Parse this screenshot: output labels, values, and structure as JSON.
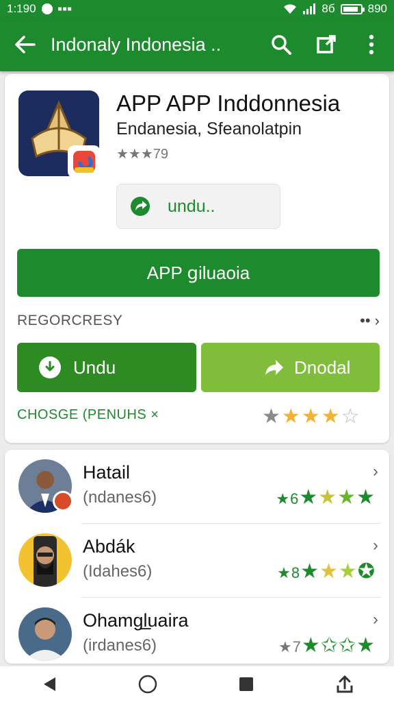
{
  "status_bar": {
    "time": "1:190",
    "signal_text": "8б",
    "battery_text": "890"
  },
  "app_bar": {
    "title": "Indonaly Indonesia .."
  },
  "app": {
    "title": "APP APP Inddonnesia",
    "subtitle": "Endanesia, Sfeanolatpin",
    "rating_text": "★★★79",
    "install_label": "undu..",
    "primary_button": "APP ցiluaoia"
  },
  "section": {
    "label": "REGORCRESY",
    "more": "•• ›"
  },
  "actions": {
    "left_label": "Undu",
    "right_label": "Dnodal"
  },
  "choose": {
    "label": "CHOSGE (PENUHS ×",
    "stars": [
      {
        "glyph": "★",
        "color": "#8a8a8a"
      },
      {
        "glyph": "★",
        "color": "#f2b233"
      },
      {
        "glyph": "★",
        "color": "#f2b233"
      },
      {
        "glyph": "★",
        "color": "#f2b233"
      },
      {
        "glyph": "☆",
        "color": "#bcbcbc"
      }
    ]
  },
  "reviews": [
    {
      "name": "Hatail",
      "sub": "(ndanes6)",
      "num": "★6",
      "stars": [
        {
          "glyph": "★",
          "color": "#1e8a2e"
        },
        {
          "glyph": "★",
          "color": "#c9c23b"
        },
        {
          "glyph": "★",
          "color": "#6ab530"
        },
        {
          "glyph": "★",
          "color": "#1e8a2e"
        }
      ]
    },
    {
      "name": "Abdák",
      "sub": "(Idahes6)",
      "num": "★8",
      "stars": [
        {
          "glyph": "★",
          "color": "#1e8a2e"
        },
        {
          "glyph": "★",
          "color": "#e2c03a"
        },
        {
          "glyph": "★",
          "color": "#a6cf3c"
        },
        {
          "glyph": "✪",
          "color": "#1e8a2e"
        }
      ]
    },
    {
      "name": "Ohamgl̲uaira",
      "sub": "(irdanes6)",
      "num": "★7",
      "stars": [
        {
          "glyph": "★",
          "color": "#1e8a2e"
        },
        {
          "glyph": "✩",
          "color": "#1e8a2e"
        },
        {
          "glyph": "✩",
          "color": "#1e8a2e"
        },
        {
          "glyph": "★",
          "color": "#1e8a2e"
        }
      ]
    }
  ]
}
